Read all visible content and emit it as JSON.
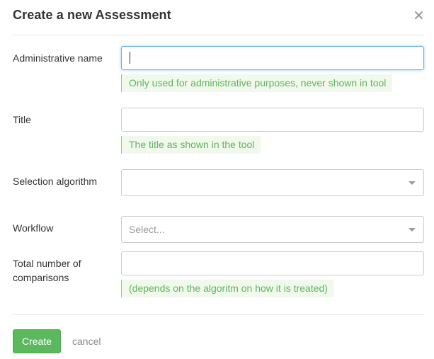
{
  "modal": {
    "title": "Create a new Assessment",
    "close_icon": "close-icon"
  },
  "form": {
    "administrative_name": {
      "label": "Administrative name",
      "value": "",
      "help": "Only used for administrative purposes, never shown in tool"
    },
    "title": {
      "label": "Title",
      "value": "",
      "help": "The title as shown in the tool"
    },
    "selection_algorithm": {
      "label": "Selection algorithm",
      "value": "",
      "icon": "chevron-down-icon"
    },
    "workflow": {
      "label": "Workflow",
      "placeholder": "Select...",
      "icon": "chevron-down-icon"
    },
    "total_comparisons": {
      "label": "Total number of comparisons",
      "value": "",
      "help": "(depends on the algoritm on how it is treated)"
    }
  },
  "footer": {
    "create_label": "Create",
    "cancel_label": "cancel"
  },
  "colors": {
    "primary_green": "#5cb85c",
    "help_bg": "#f1f8ec",
    "focus_blue": "#66afe9"
  }
}
